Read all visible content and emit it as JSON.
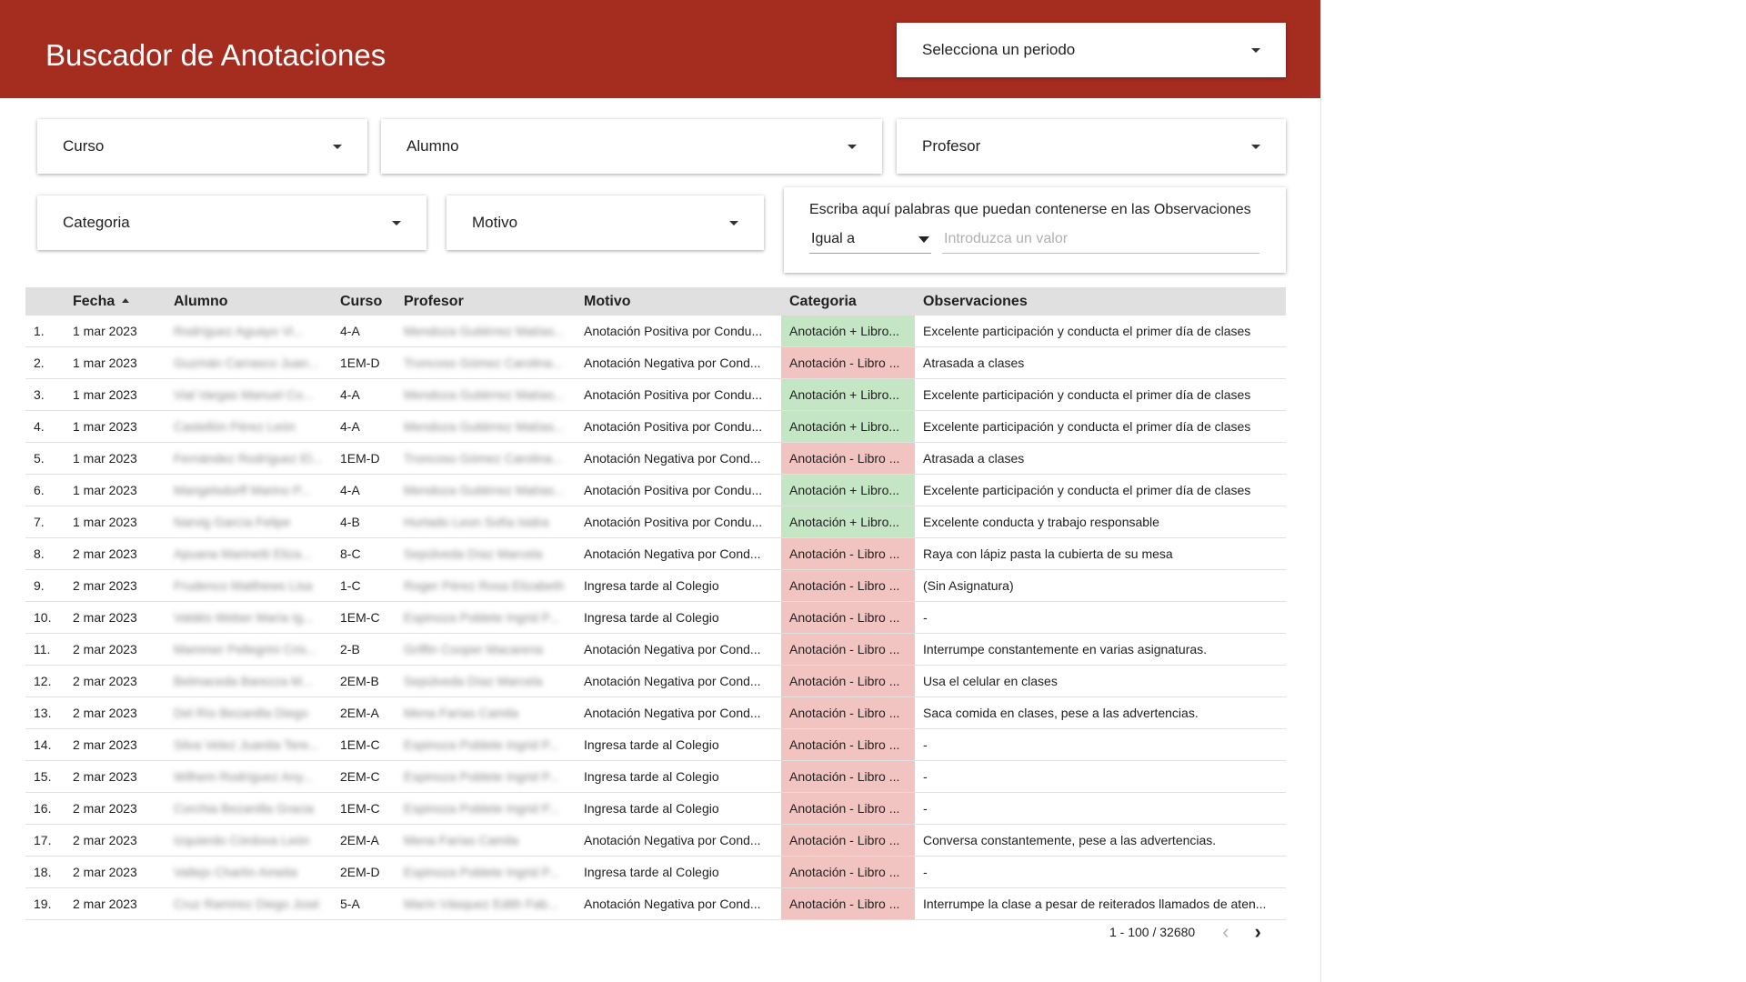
{
  "header": {
    "title": "Buscador de Anotaciones",
    "period_select": "Selecciona un periodo"
  },
  "filters": {
    "curso": "Curso",
    "alumno": "Alumno",
    "profesor": "Profesor",
    "categoria": "Categoria",
    "motivo": "Motivo"
  },
  "search": {
    "label": "Escriba aquí palabras que puedan contenerse en las Observaciones",
    "operator": "Igual a",
    "placeholder": "Introduzca un valor"
  },
  "table": {
    "columns": [
      "",
      "Fecha",
      "Alumno",
      "Curso",
      "Profesor",
      "Motivo",
      "Categoria",
      "Observaciones"
    ],
    "sorted_column": "Fecha",
    "rows": [
      {
        "n": "1.",
        "fecha": "1 mar 2023",
        "alumno": "Rodríguez Aguayo Vi...",
        "curso": "4-A",
        "profesor": "Mendoza Gutiérrez Matías...",
        "motivo": "Anotación Positiva por Condu...",
        "categoria": "Anotación + Libro...",
        "cat": "pos",
        "obs": "Excelente participación y conducta el primer día de clases"
      },
      {
        "n": "2.",
        "fecha": "1 mar 2023",
        "alumno": "Guzmán Carrasco Juan...",
        "curso": "1EM-D",
        "profesor": "Troncoso Gómez Carolina...",
        "motivo": "Anotación Negativa por Cond...",
        "categoria": "Anotación - Libro ...",
        "cat": "neg",
        "obs": "Atrasada a clases"
      },
      {
        "n": "3.",
        "fecha": "1 mar 2023",
        "alumno": "Vial Vargas Manuel Co...",
        "curso": "4-A",
        "profesor": "Mendoza Gutiérrez Matías...",
        "motivo": "Anotación Positiva por Condu...",
        "categoria": "Anotación + Libro...",
        "cat": "pos",
        "obs": "Excelente participación y conducta el primer día de clases"
      },
      {
        "n": "4.",
        "fecha": "1 mar 2023",
        "alumno": "Castellón Pérez León",
        "curso": "4-A",
        "profesor": "Mendoza Gutiérrez Matías...",
        "motivo": "Anotación Positiva por Condu...",
        "categoria": "Anotación + Libro...",
        "cat": "pos",
        "obs": "Excelente participación y conducta el primer día de clases"
      },
      {
        "n": "5.",
        "fecha": "1 mar 2023",
        "alumno": "Fernández Rodríguez El...",
        "curso": "1EM-D",
        "profesor": "Troncoso Gómez Carolina...",
        "motivo": "Anotación Negativa por Cond...",
        "categoria": "Anotación - Libro ...",
        "cat": "neg",
        "obs": "Atrasada a clases"
      },
      {
        "n": "6.",
        "fecha": "1 mar 2023",
        "alumno": "Mangelsdorff Marino P...",
        "curso": "4-A",
        "profesor": "Mendoza Gutiérrez Matías...",
        "motivo": "Anotación Positiva por Condu...",
        "categoria": "Anotación + Libro...",
        "cat": "pos",
        "obs": "Excelente participación y conducta el primer día de clases"
      },
      {
        "n": "7.",
        "fecha": "1 mar 2023",
        "alumno": "Narvig García Felipe",
        "curso": "4-B",
        "profesor": "Hurtado Leon Sofía Isidra",
        "motivo": "Anotación Positiva por Condu...",
        "categoria": "Anotación + Libro...",
        "cat": "pos",
        "obs": "Excelente conducta y trabajo responsable"
      },
      {
        "n": "8.",
        "fecha": "2 mar 2023",
        "alumno": "Apuana Marinetti Eliza...",
        "curso": "8-C",
        "profesor": "Sepúlveda Díaz Marcela",
        "motivo": "Anotación Negativa por Cond...",
        "categoria": "Anotación - Libro ...",
        "cat": "neg",
        "obs": "Raya con lápiz pasta la cubierta de su mesa"
      },
      {
        "n": "9.",
        "fecha": "2 mar 2023",
        "alumno": "Frudenco Matthews Lisa",
        "curso": "1-C",
        "profesor": "Roger Pérez Rosa Elizabeth",
        "motivo": "Ingresa tarde al Colegio",
        "categoria": "Anotación - Libro ...",
        "cat": "neg",
        "obs": "(Sin Asignatura)"
      },
      {
        "n": "10.",
        "fecha": "2 mar 2023",
        "alumno": "Valdés Weber María Ig...",
        "curso": "1EM-C",
        "profesor": "Espinoza Poblete Ingrid P...",
        "motivo": "Ingresa tarde al Colegio",
        "categoria": "Anotación - Libro ...",
        "cat": "neg",
        "obs": "-"
      },
      {
        "n": "11.",
        "fecha": "2 mar 2023",
        "alumno": "Mammer Pellegrini Cris...",
        "curso": "2-B",
        "profesor": "Griffin Cooper Macarena",
        "motivo": "Anotación Negativa por Cond...",
        "categoria": "Anotación - Libro ...",
        "cat": "neg",
        "obs": "Interrumpe constantemente en varias asignaturas."
      },
      {
        "n": "12.",
        "fecha": "2 mar 2023",
        "alumno": "Belmaceda Barezza M...",
        "curso": "2EM-B",
        "profesor": "Sepúlveda Díaz Marcela",
        "motivo": "Anotación Negativa por Cond...",
        "categoria": "Anotación - Libro ...",
        "cat": "neg",
        "obs": "Usa el celular en clases"
      },
      {
        "n": "13.",
        "fecha": "2 mar 2023",
        "alumno": "Del Río Bezanilla Diego",
        "curso": "2EM-A",
        "profesor": "Mena Farías Camila",
        "motivo": "Anotación Negativa por Cond...",
        "categoria": "Anotación - Libro ...",
        "cat": "neg",
        "obs": "Saca comida en clases, pese a las advertencias."
      },
      {
        "n": "14.",
        "fecha": "2 mar 2023",
        "alumno": "Silva Velez Juanita Tere...",
        "curso": "1EM-C",
        "profesor": "Espinoza Poblete Ingrid P...",
        "motivo": "Ingresa tarde al Colegio",
        "categoria": "Anotación - Libro ...",
        "cat": "neg",
        "obs": "-"
      },
      {
        "n": "15.",
        "fecha": "2 mar 2023",
        "alumno": "Wilhem Rodríguez Any...",
        "curso": "2EM-C",
        "profesor": "Espinoza Poblete Ingrid P...",
        "motivo": "Ingresa tarde al Colegio",
        "categoria": "Anotación - Libro ...",
        "cat": "neg",
        "obs": "-"
      },
      {
        "n": "16.",
        "fecha": "2 mar 2023",
        "alumno": "Corchia Bezanilla Gracia",
        "curso": "1EM-C",
        "profesor": "Espinoza Poblete Ingrid P...",
        "motivo": "Ingresa tarde al Colegio",
        "categoria": "Anotación - Libro ...",
        "cat": "neg",
        "obs": "-"
      },
      {
        "n": "17.",
        "fecha": "2 mar 2023",
        "alumno": "Izquierdo Córdova León",
        "curso": "2EM-A",
        "profesor": "Mena Farías Camila",
        "motivo": "Anotación Negativa por Cond...",
        "categoria": "Anotación - Libro ...",
        "cat": "neg",
        "obs": "Conversa constantemente, pese a las advertencias."
      },
      {
        "n": "18.",
        "fecha": "2 mar 2023",
        "alumno": "Vallejo Charlín Amelia",
        "curso": "2EM-D",
        "profesor": "Espinoza Poblete Ingrid P...",
        "motivo": "Ingresa tarde al Colegio",
        "categoria": "Anotación - Libro ...",
        "cat": "neg",
        "obs": "-"
      },
      {
        "n": "19.",
        "fecha": "2 mar 2023",
        "alumno": "Cruz Ramírez Diego José",
        "curso": "5-A",
        "profesor": "Marín Vásquez Edith Fab...",
        "motivo": "Anotación Negativa por Cond...",
        "categoria": "Anotación - Libro ...",
        "cat": "neg",
        "obs": "Interrumpe la clase a pesar de reiterados llamados de aten..."
      }
    ]
  },
  "pagination": {
    "range": "1 - 100 / 32680",
    "prev": "‹",
    "next": "›"
  },
  "colors": {
    "header": "#a42d20",
    "category_positive": "#c5e6c4",
    "category_negative": "#f2c4c1"
  }
}
